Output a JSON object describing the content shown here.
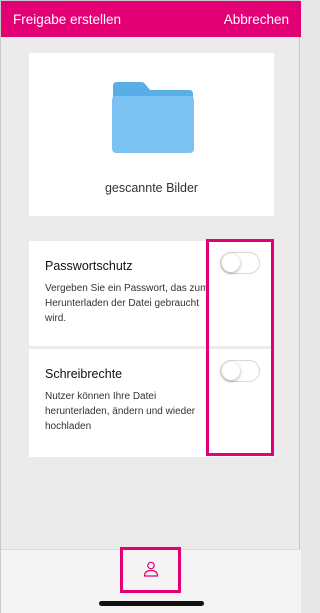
{
  "header": {
    "title": "Freigabe erstellen",
    "cancel_label": "Abbrechen",
    "accent_color": "#e20074"
  },
  "folder": {
    "icon": "folder-icon",
    "name": "gescannte Bilder",
    "icon_color": "#6cb9f0"
  },
  "options": [
    {
      "title": "Passwortschutz",
      "description": "Vergeben Sie ein Passwort, das zum Herunterladen der Datei gebraucht wird.",
      "enabled": false
    },
    {
      "title": "Schreibrechte",
      "description": "Nutzer können Ihre Datei herunterladen, ändern und wieder hochladen",
      "enabled": false
    }
  ],
  "bottom": {
    "icon": "user-icon"
  }
}
